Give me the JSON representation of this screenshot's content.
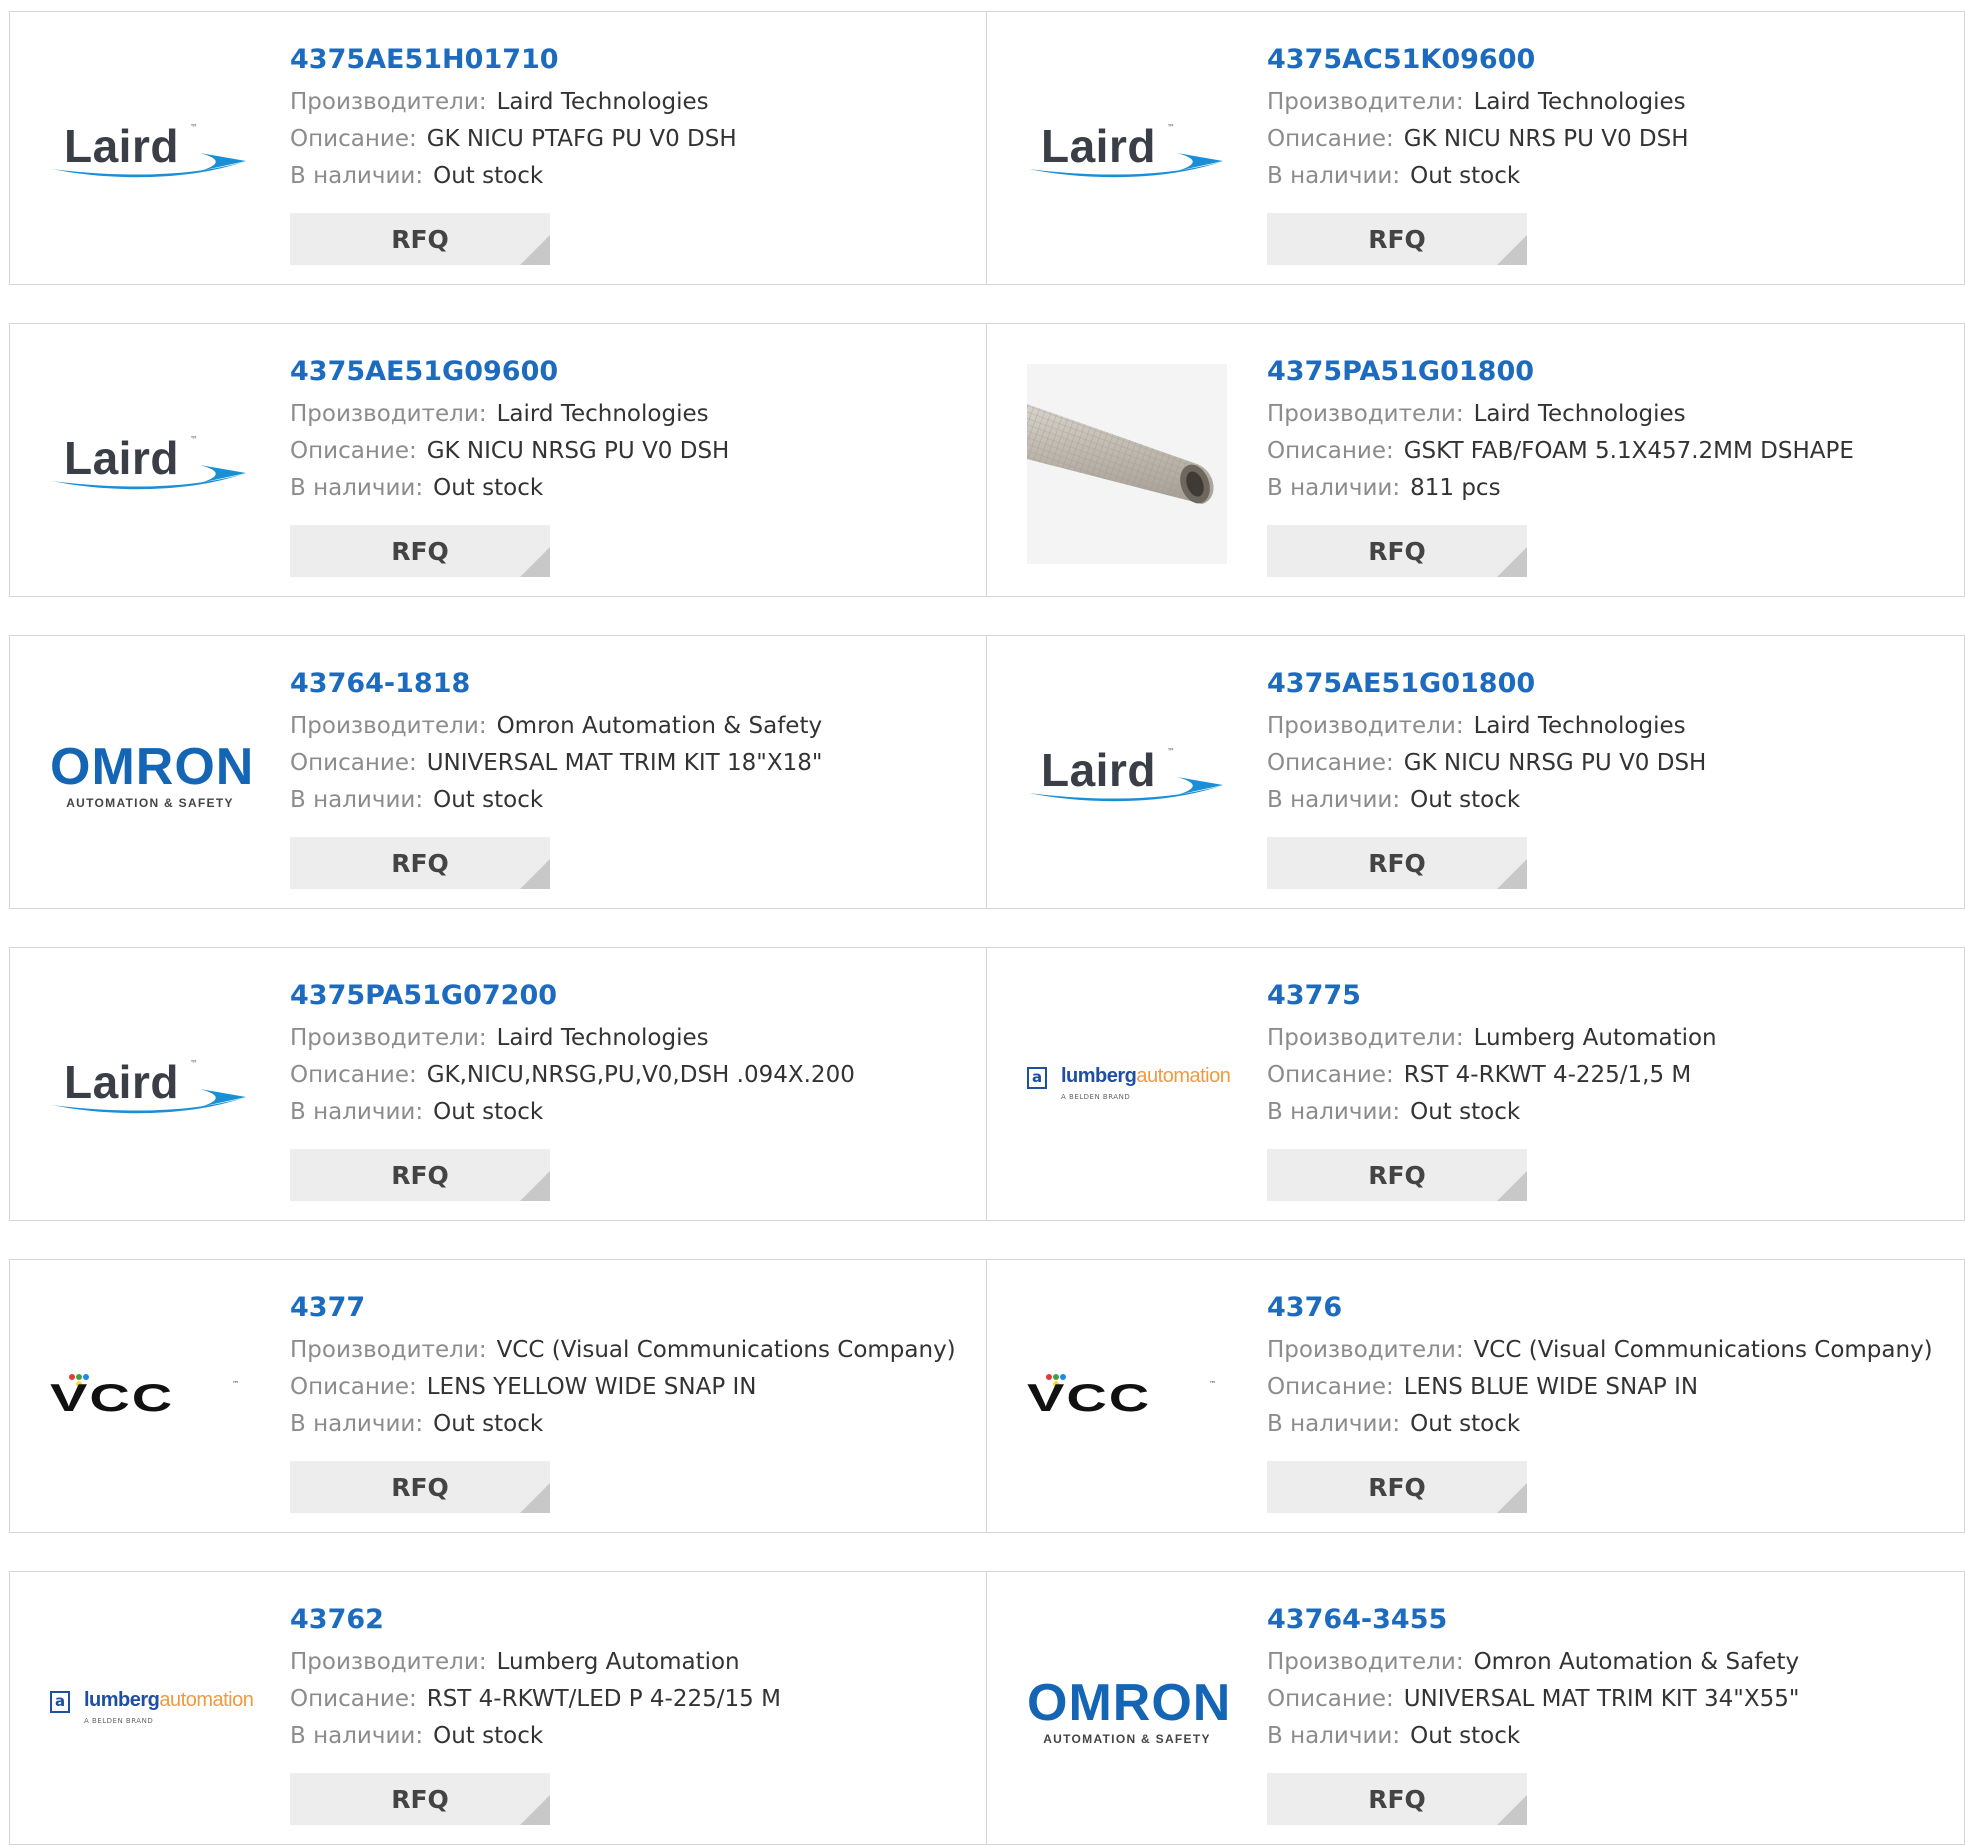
{
  "labels": {
    "manufacturer": "Производители:",
    "description": "Описание:",
    "stock": "В наличии:",
    "rfq": "RFQ"
  },
  "logos": {
    "laird": {
      "text": "Laird",
      "tm": "™"
    },
    "omron": {
      "text": "OMRON",
      "sub": "AUTOMATION & SAFETY"
    },
    "lumberg": {
      "icon": "a",
      "text_a": "lumberg",
      "text_b": "automation",
      "sub": "A BELDEN BRAND"
    },
    "vcc": {
      "text": "VCC",
      "tm": "™"
    }
  },
  "colors": {
    "part_number": "#1d6bbf",
    "label": "#8c8c8c",
    "value": "#333333",
    "rfq_bg": "#ededed"
  },
  "products": [
    {
      "part": "4375AE51H01710",
      "manufacturer": "Laird Technologies",
      "description": "GK NICU PTAFG PU V0 DSH",
      "stock": "Out stock",
      "logo": "laird"
    },
    {
      "part": "4375AC51K09600",
      "manufacturer": "Laird Technologies",
      "description": "GK NICU NRS PU V0 DSH",
      "stock": "Out stock",
      "logo": "laird"
    },
    {
      "part": "4375AE51G09600",
      "manufacturer": "Laird Technologies",
      "description": "GK NICU NRSG PU V0 DSH",
      "stock": "Out stock",
      "logo": "laird"
    },
    {
      "part": "4375PA51G01800",
      "manufacturer": "Laird Technologies",
      "description": "GSKT FAB/FOAM 5.1X457.2MM DSHAPE",
      "stock": "811 pcs",
      "logo": "gasket-photo"
    },
    {
      "part": "43764-1818",
      "manufacturer": "Omron Automation & Safety",
      "description": "UNIVERSAL MAT TRIM KIT 18\"X18\"",
      "stock": "Out stock",
      "logo": "omron"
    },
    {
      "part": "4375AE51G01800",
      "manufacturer": "Laird Technologies",
      "description": "GK NICU NRSG PU V0 DSH",
      "stock": "Out stock",
      "logo": "laird"
    },
    {
      "part": "4375PA51G07200",
      "manufacturer": "Laird Technologies",
      "description": "GK,NICU,NRSG,PU,V0,DSH .094X.200",
      "stock": "Out stock",
      "logo": "laird"
    },
    {
      "part": "43775",
      "manufacturer": "Lumberg Automation",
      "description": "RST 4-RKWT 4-225/1,5 M",
      "stock": "Out stock",
      "logo": "lumberg"
    },
    {
      "part": "4377",
      "manufacturer": "VCC (Visual Communications Company)",
      "description": "LENS YELLOW WIDE SNAP IN",
      "stock": "Out stock",
      "logo": "vcc"
    },
    {
      "part": "4376",
      "manufacturer": "VCC (Visual Communications Company)",
      "description": "LENS BLUE WIDE SNAP IN",
      "stock": "Out stock",
      "logo": "vcc"
    },
    {
      "part": "43762",
      "manufacturer": "Lumberg Automation",
      "description": "RST 4-RKWT/LED P 4-225/15 M",
      "stock": "Out stock",
      "logo": "lumberg"
    },
    {
      "part": "43764-3455",
      "manufacturer": "Omron Automation & Safety",
      "description": "UNIVERSAL MAT TRIM KIT 34\"X55\"",
      "stock": "Out stock",
      "logo": "omron"
    }
  ]
}
